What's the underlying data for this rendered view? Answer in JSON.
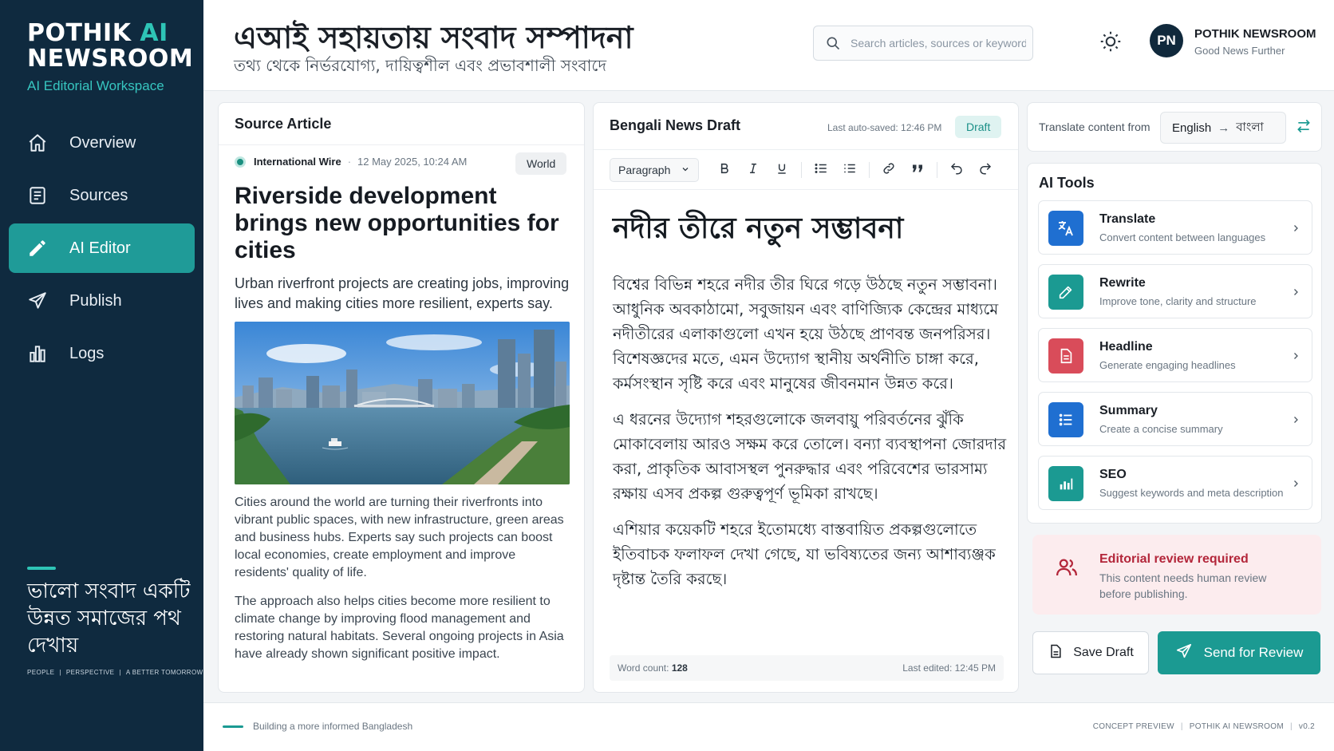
{
  "sidebar": {
    "brand_line1_a": "POTHIK ",
    "brand_line1_b": "AI",
    "brand_line2": "NEWSROOM",
    "brand_sub": "AI Editorial Workspace",
    "items": [
      {
        "label": "Overview",
        "icon": "home-icon"
      },
      {
        "label": "Sources",
        "icon": "document-icon"
      },
      {
        "label": "AI Editor",
        "icon": "pencil-icon",
        "active": true
      },
      {
        "label": "Publish",
        "icon": "send-icon"
      },
      {
        "label": "Logs",
        "icon": "bar-chart-icon"
      }
    ],
    "tagline": "ভালো সংবাদ একটি উন্নত সমাজের পথ দেখায়",
    "foot": [
      "PEOPLE",
      "PERSPECTIVE",
      "A BETTER TOMORROW"
    ]
  },
  "header": {
    "title": "এআই সহায়তায় সংবাদ সম্পাদনা",
    "subtitle": "তথ্য থেকে নির্ভরযোগ্য, দায়িত্বশীল এবং প্রভাবশালী সংবাদে",
    "search_placeholder": "Search articles, sources or keywords...",
    "avatar_initials": "PN",
    "user_name": "POTHIK NEWSROOM",
    "user_org": "Good News Further"
  },
  "source": {
    "heading": "Source Article",
    "wire": "International Wire",
    "sep": "·",
    "date": "12 May 2025, 10:24 AM",
    "tag": "World",
    "title": "Riverside development brings new opportunities for cities",
    "lede": "Urban riverfront projects are creating jobs, improving lives and making cities more resilient, experts say.",
    "body": [
      "Cities around the world are turning their riverfronts into vibrant public spaces, with new infrastructure, green areas and business hubs. Experts say such projects can boost local economies, create employment and improve residents' quality of life.",
      "The approach also helps cities become more resilient to climate change by improving flood management and restoring natural habitats. Several ongoing projects in Asia have already shown significant positive impact."
    ]
  },
  "editor": {
    "heading": "Bengali News Draft",
    "autosave": "Last auto-saved: 12:46 PM",
    "status": "Draft",
    "block_format": "Paragraph",
    "headline": "নদীর তীরে নতুন সম্ভাবনা",
    "paragraphs": [
      "বিশ্বের বিভিন্ন শহরে নদীর তীর ঘিরে গড়ে উঠছে নতুন সম্ভাবনা। আধুনিক অবকাঠামো, সবুজায়ন এবং বাণিজ্যিক কেন্দ্রের মাধ্যমে নদীতীরের এলাকাগুলো এখন হয়ে উঠছে প্রাণবন্ত জনপরিসর। বিশেষজ্ঞদের মতে, এমন উদ্যোগ স্থানীয় অর্থনীতি চাঙ্গা করে, কর্মসংস্থান সৃষ্টি করে এবং মানুষের জীবনমান উন্নত করে।",
      "এ ধরনের উদ্যোগ শহরগুলোকে জলবায়ু পরিবর্তনের ঝুঁকি মোকাবেলায় আরও সক্ষম করে তোলে। বন্যা ব্যবস্থাপনা জোরদার করা, প্রাকৃতিক আবাসস্থল পুনরুদ্ধার এবং পরিবেশের ভারসাম্য রক্ষায় এসব প্রকল্প গুরুত্বপূর্ণ ভূমিকা রাখছে।",
      "এশিয়ার কয়েকটি শহরে ইতোমধ্যে বাস্তবায়িত প্রকল্পগুলোতে ইতিবাচক ফলাফল দেখা গেছে, যা ভবিষ্যতের জন্য আশাব্যঞ্জক দৃষ্টান্ত তৈরি করছে।"
    ],
    "word_count_label": "Word count:",
    "word_count": "128",
    "last_edited": "Last edited: 12:45 PM"
  },
  "translate": {
    "label": "Translate content from",
    "from": "English",
    "arrow": "→",
    "to": "বাংলা"
  },
  "tools": {
    "title": "AI Tools",
    "items": [
      {
        "name": "Translate",
        "desc": "Convert content between languages",
        "color": "#1f6fd1"
      },
      {
        "name": "Rewrite",
        "desc": "Improve tone, clarity and structure",
        "color": "#1b9a92"
      },
      {
        "name": "Headline",
        "desc": "Generate engaging headlines",
        "color": "#d94c5a"
      },
      {
        "name": "Summary",
        "desc": "Create a concise summary",
        "color": "#1f6fd1"
      },
      {
        "name": "SEO",
        "desc": "Suggest keywords and meta description",
        "color": "#1b9a92"
      }
    ]
  },
  "review": {
    "title": "Editorial review required",
    "text": "This content needs human review before publishing."
  },
  "actions": {
    "save": "Save Draft",
    "send": "Send for Review"
  },
  "footer": {
    "left": "Building a more informed Bangladesh",
    "right": [
      "CONCEPT PREVIEW",
      "POTHIK AI NEWSROOM",
      "v0.2"
    ]
  }
}
